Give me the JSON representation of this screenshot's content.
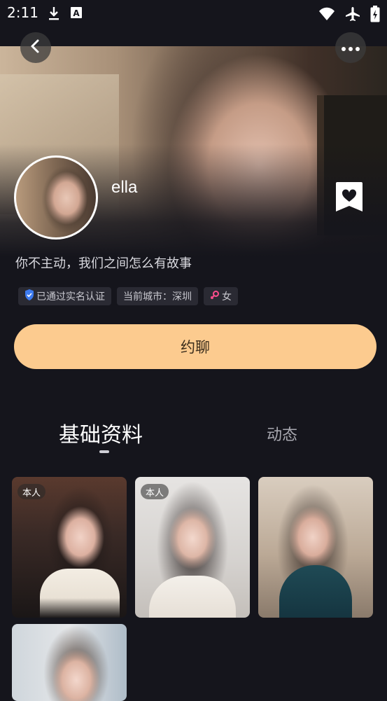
{
  "status_bar": {
    "time": "2:11",
    "left_icons": [
      "download-icon",
      "a-square-icon"
    ],
    "right_icons": [
      "wifi-icon",
      "airplane-icon",
      "battery-charging-icon"
    ]
  },
  "header": {
    "back_icon": "chevron-left-icon",
    "more_icon": "more-horizontal-icon"
  },
  "profile": {
    "username": "ella",
    "bio": "你不主动，我们之间怎么有故事",
    "tags": [
      {
        "icon": "verified-shield-icon",
        "label": "已通过实名认证"
      },
      {
        "label": "当前城市：深圳"
      },
      {
        "icon": "female-icon",
        "label": "女"
      }
    ],
    "bookmark_icon": "heart-bookmark-icon"
  },
  "cta": {
    "label": "约聊",
    "color": "#fccb8f"
  },
  "tabs": [
    {
      "label": "基础资料",
      "active": true
    },
    {
      "label": "动态",
      "active": false
    }
  ],
  "photos": [
    {
      "badge": "本人"
    },
    {
      "badge": "本人"
    },
    {
      "badge": ""
    },
    {
      "badge": ""
    }
  ],
  "colors": {
    "background": "#15151c",
    "tag_bg": "#2a2a33",
    "accent": "#fccb8f"
  }
}
